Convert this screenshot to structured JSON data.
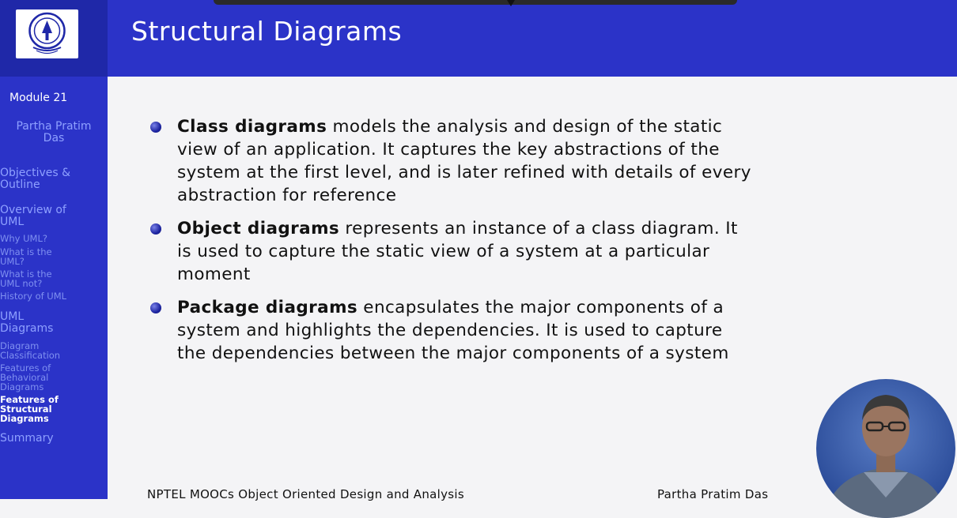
{
  "slide": {
    "title": "Structural Diagrams"
  },
  "sidebar": {
    "module": "Module 21",
    "author_line1": "Partha Pratim",
    "author_line2": "Das",
    "items": [
      {
        "label1": "Objectives &",
        "label2": "Outline"
      },
      {
        "label1": "Overview of",
        "label2": "UML"
      },
      {
        "label1": "Why UML?"
      },
      {
        "label1": "What is the",
        "label2": "UML?"
      },
      {
        "label1": "What is the",
        "label2": "UML not?"
      },
      {
        "label1": "History of UML"
      },
      {
        "label1": "UML",
        "label2": "Diagrams"
      },
      {
        "label1": "Diagram",
        "label2": "Classification"
      },
      {
        "label1": "Features of",
        "label2": "Behavioral",
        "label3": "Diagrams"
      },
      {
        "label1": "Features of",
        "label2": "Structural",
        "label3": "Diagrams"
      },
      {
        "label1": "Summary"
      }
    ]
  },
  "bullets": [
    {
      "term": "Class diagrams",
      "line1": " models the analysis and design of the static",
      "line2": "view of an application. It captures the key abstractions of the",
      "line3": "system at the first level, and is later refined with details of every",
      "line4": "abstraction for reference"
    },
    {
      "term": "Object diagrams",
      "line1": " represents an instance of a class diagram. It",
      "line2": "is used to capture the static view of a system at a particular",
      "line3": "moment"
    },
    {
      "term": "Package diagrams",
      "line1": " encapsulates the major components of a",
      "line2": "system and highlights the dependencies. It is used to capture",
      "line3": "the dependencies between the major components of a system"
    }
  ],
  "footer": {
    "left": "NPTEL MOOCs Object Oriented Design and Analysis",
    "right": "Partha Pratim Das"
  },
  "colors": {
    "theme_blue": "#2b33c8",
    "sidebar_text": "#8ea0ff"
  }
}
